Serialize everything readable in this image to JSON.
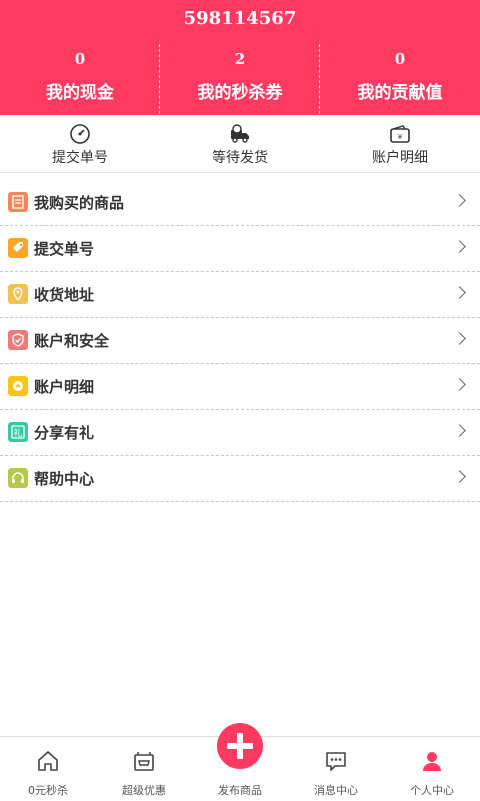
{
  "header": {
    "user_id": "598114567",
    "stats": [
      {
        "value": "0",
        "label": "我的现金"
      },
      {
        "value": "2",
        "label": "我的秒杀券"
      },
      {
        "value": "0",
        "label": "我的贡献值"
      }
    ]
  },
  "quick": [
    {
      "label": "提交单号",
      "icon": "speedometer-icon"
    },
    {
      "label": "等待发货",
      "icon": "delivery-truck-icon"
    },
    {
      "label": "账户明细",
      "icon": "wallet-icon"
    }
  ],
  "menu": [
    {
      "label": "我购买的商品",
      "icon": "document-icon",
      "color": "#f0875b"
    },
    {
      "label": "提交单号",
      "icon": "tag-icon",
      "color": "#f5a623"
    },
    {
      "label": "收货地址",
      "icon": "location-pin-icon",
      "color": "#f2c14e"
    },
    {
      "label": "账户和安全",
      "icon": "shield-icon",
      "color": "#f07a7a"
    },
    {
      "label": "账户明细",
      "icon": "coin-icon",
      "color": "#f5c518"
    },
    {
      "label": "分享有礼",
      "icon": "gift-icon",
      "color": "#36c9a4"
    },
    {
      "label": "帮助中心",
      "icon": "headset-icon",
      "color": "#b7c94a"
    }
  ],
  "tabbar": [
    {
      "label": "0元秒杀",
      "icon": "home-icon"
    },
    {
      "label": "超级优惠",
      "icon": "shop-icon"
    },
    {
      "label": "发布商品",
      "icon": "plus-icon"
    },
    {
      "label": "消息中心",
      "icon": "message-icon"
    },
    {
      "label": "个人中心",
      "icon": "person-icon"
    }
  ],
  "colors": {
    "brand": "#fe3a61"
  }
}
